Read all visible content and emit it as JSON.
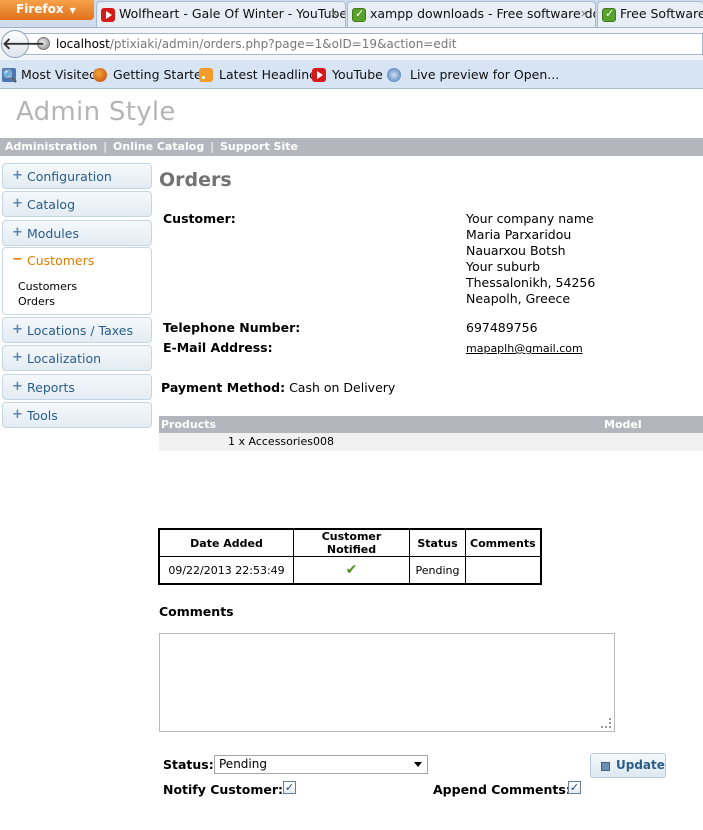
{
  "browser": {
    "menu_button": "Firefox",
    "tabs": [
      {
        "title": "Wolfheart - Gale Of Winter - YouTube",
        "icon": "youtube-icon"
      },
      {
        "title": "xampp downloads - Free software do...",
        "icon": "xampp-icon"
      },
      {
        "title": "Free Software D",
        "icon": "xampp-icon"
      }
    ],
    "tab_close": "×",
    "url_host": "localhost",
    "url_path": "/ptixiaki/admin/orders.php?page=1&oID=19&action=edit",
    "bookmarks": [
      "Most Visited",
      "Getting Started",
      "Latest Headlines",
      "YouTube",
      "Live preview for Open..."
    ]
  },
  "site": {
    "title": "Admin Style",
    "top_menu": [
      "Administration",
      "Online Catalog",
      "Support Site"
    ],
    "menu_separator": "|"
  },
  "sidebar": {
    "items": [
      {
        "label": "Configuration",
        "expanded": false
      },
      {
        "label": "Catalog",
        "expanded": false
      },
      {
        "label": "Modules",
        "expanded": false
      },
      {
        "label": "Customers",
        "expanded": true,
        "children": [
          "Customers",
          "Orders"
        ]
      },
      {
        "label": "Locations / Taxes",
        "expanded": false
      },
      {
        "label": "Localization",
        "expanded": false
      },
      {
        "label": "Reports",
        "expanded": false
      },
      {
        "label": "Tools",
        "expanded": false
      }
    ]
  },
  "order": {
    "page_title": "Orders",
    "customer_label": "Customer:",
    "address_lines": [
      "Your company name",
      "Maria Parxaridou",
      "Nauarxou Botsh",
      "Your suburb",
      "Thessalonikh, 54256",
      "Neapolh, Greece"
    ],
    "telephone_label": "Telephone Number:",
    "telephone": "697489756",
    "email_label": "E-Mail Address:",
    "email": "mapaplh@gmail.com",
    "payment_label": "Payment Method:",
    "payment_method": "Cash on Delivery",
    "products_header": "Products",
    "model_header": "Model",
    "product_line": "1 x Accessories008"
  },
  "history": {
    "headers": [
      "Date Added",
      "Customer Notified",
      "Status",
      "Comments"
    ],
    "rows": [
      {
        "date": "09/22/2013 22:53:49",
        "notified": true,
        "status": "Pending",
        "comments": ""
      }
    ]
  },
  "form": {
    "comments_label": "Comments",
    "comments_value": "",
    "status_label": "Status:",
    "status_value": "Pending",
    "notify_label": "Notify Customer:",
    "notify_checked": true,
    "append_label": "Append Comments:",
    "append_checked": true,
    "update_button": "Update"
  },
  "colors": {
    "accent_orange": "#e07b00",
    "link_blue": "#2a5d8a",
    "menu_bar": "#b3b6bd",
    "title_grey": "#727272",
    "check_green": "#4b8f1f"
  }
}
